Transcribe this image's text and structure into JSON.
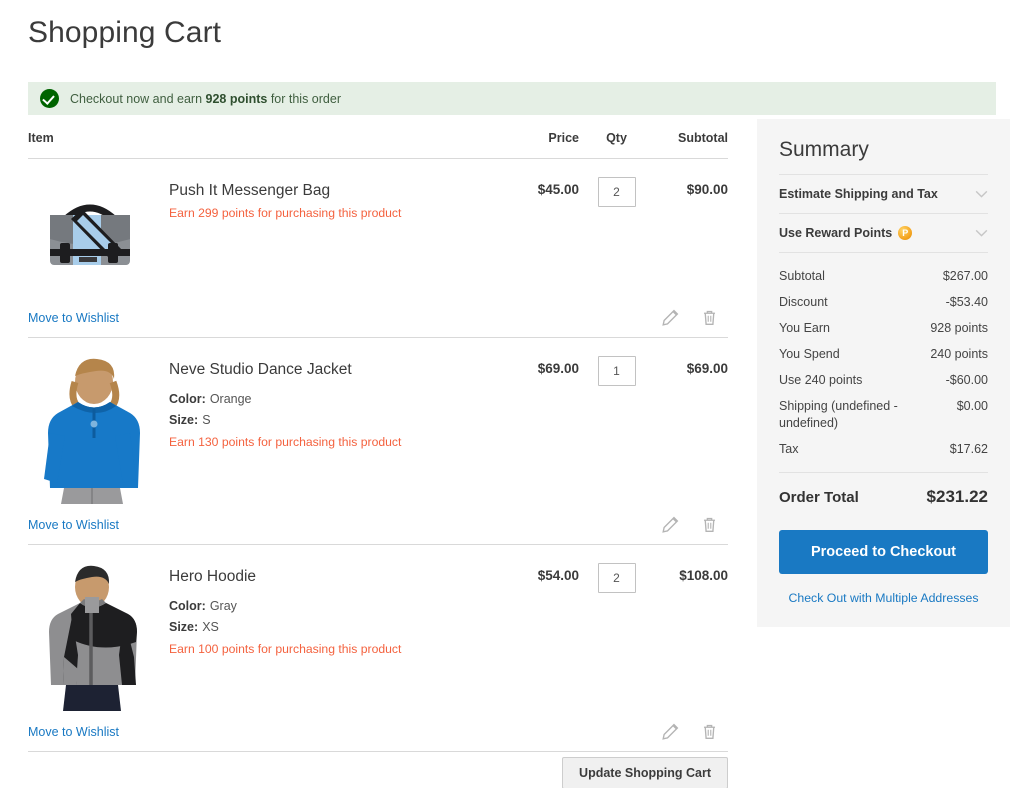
{
  "page": {
    "title": "Shopping Cart"
  },
  "banner": {
    "icon": "check-circle-icon",
    "prefix": "Checkout now and earn ",
    "highlight": "928 points",
    "suffix": " for this order"
  },
  "table": {
    "headers": {
      "item": "Item",
      "price": "Price",
      "qty": "Qty",
      "subtotal": "Subtotal"
    },
    "wishlist_label": "Move to Wishlist",
    "edit_icon": "pencil-icon",
    "delete_icon": "trash-icon"
  },
  "items": [
    {
      "name": "Push It Messenger Bag",
      "earn": "Earn 299 points for purchasing this product",
      "price": "$45.00",
      "qty": "2",
      "subtotal": "$90.00",
      "options": [],
      "image": "messenger-bag-thumbnail"
    },
    {
      "name": "Neve Studio Dance Jacket",
      "earn": "Earn 130 points for purchasing this product",
      "price": "$69.00",
      "qty": "1",
      "subtotal": "$69.00",
      "options": [
        {
          "label": "Color:",
          "value": "Orange"
        },
        {
          "label": "Size:",
          "value": "S"
        }
      ],
      "image": "dance-jacket-thumbnail"
    },
    {
      "name": "Hero Hoodie",
      "earn": "Earn 100 points for purchasing this product",
      "price": "$54.00",
      "qty": "2",
      "subtotal": "$108.00",
      "options": [
        {
          "label": "Color:",
          "value": "Gray"
        },
        {
          "label": "Size:",
          "value": "XS"
        }
      ],
      "image": "hero-hoodie-thumbnail"
    }
  ],
  "actions": {
    "update_cart": "Update Shopping Cart"
  },
  "summary": {
    "title": "Summary",
    "accordions": [
      {
        "label": "Estimate Shipping and Tax",
        "badge": ""
      },
      {
        "label": "Use Reward Points",
        "badge": "P"
      }
    ],
    "totals": [
      {
        "label": "Subtotal",
        "value": "$267.00"
      },
      {
        "label": "Discount",
        "value": "-$53.40"
      },
      {
        "label": "You Earn",
        "value": "928 points"
      },
      {
        "label": "You Spend",
        "value": "240 points"
      },
      {
        "label": "Use 240 points",
        "value": "-$60.00"
      },
      {
        "label": "Shipping (undefined - undefined)",
        "value": "$0.00"
      },
      {
        "label": "Tax",
        "value": "$17.62"
      }
    ],
    "order_total_label": "Order Total",
    "order_total_value": "$231.22",
    "checkout_button": "Proceed to Checkout",
    "multi_address_link": "Check Out with Multiple Addresses"
  },
  "colors": {
    "accent_blue": "#1979c3",
    "banner_green_bg": "#e5efe5",
    "earn_orange": "#f4623f",
    "panel_gray": "#f5f5f5"
  }
}
